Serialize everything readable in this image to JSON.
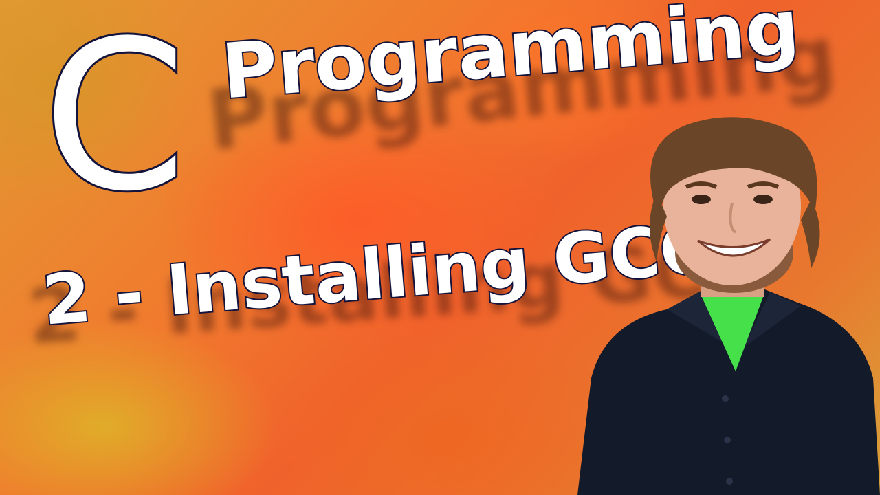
{
  "thumbnail": {
    "title_letter": "C",
    "title_word": "Programming",
    "subtitle": "2 - Installing GCC"
  },
  "colors": {
    "text_fill": "#ffffff",
    "text_outline": "#14143c",
    "background_primary": "#f0622b",
    "background_secondary": "#e2a233",
    "shirt": "#131a2a",
    "undershirt": "#45e04a"
  }
}
